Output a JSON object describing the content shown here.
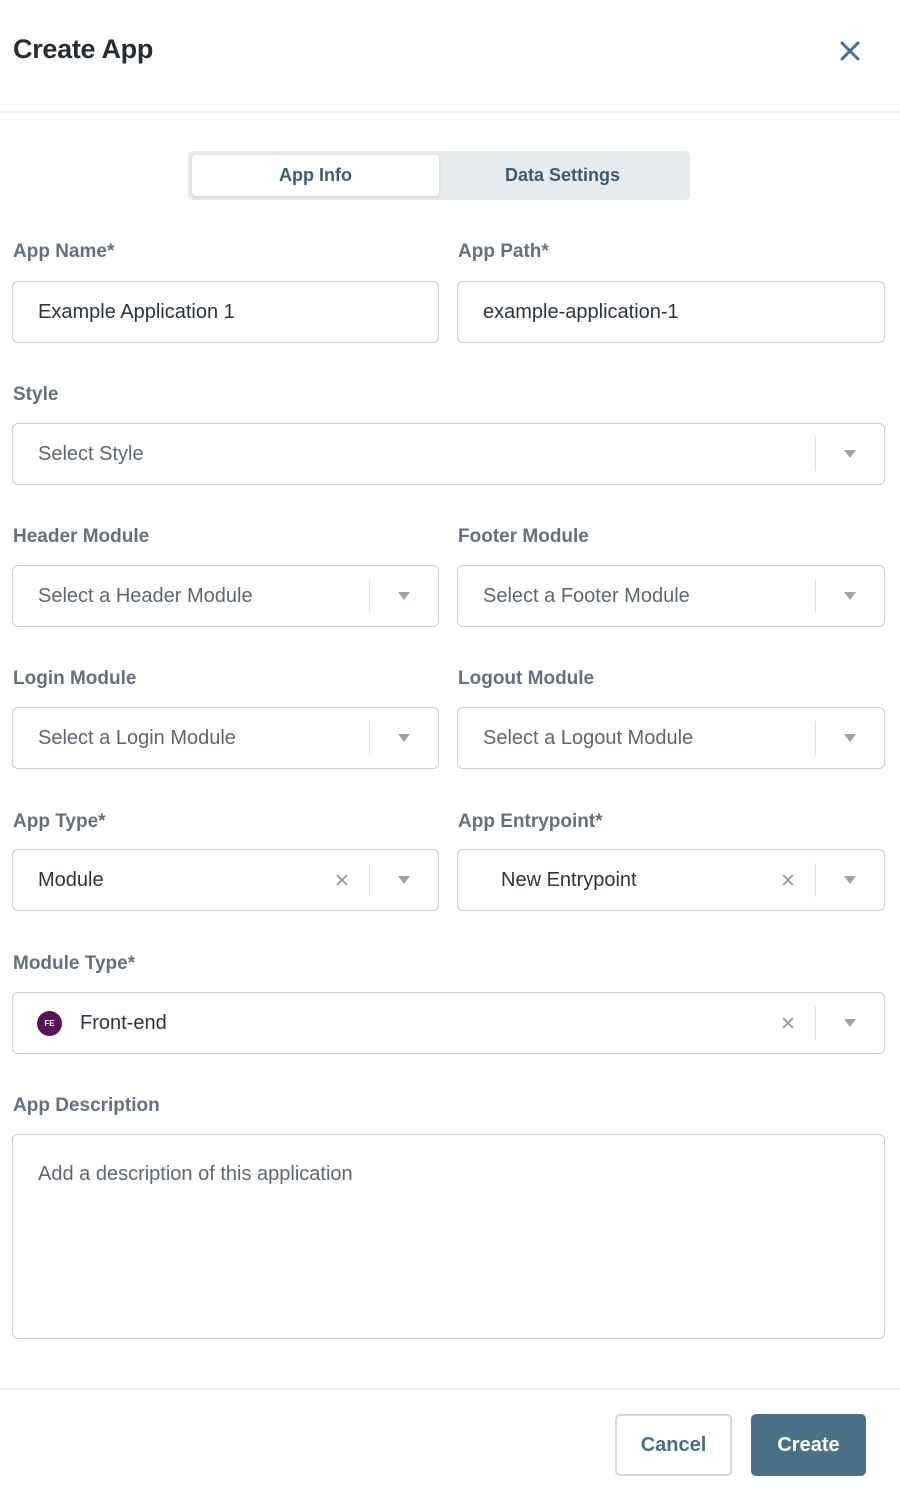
{
  "dialog": {
    "title": "Create App",
    "close_icon": "close-icon"
  },
  "tabs": [
    {
      "label": "App Info",
      "active": true
    },
    {
      "label": "Data Settings",
      "active": false
    }
  ],
  "fields": {
    "app_name": {
      "label": "App Name*",
      "value": "Example Application 1"
    },
    "app_path": {
      "label": "App Path*",
      "value": "example-application-1"
    },
    "style": {
      "label": "Style",
      "placeholder": "Select Style"
    },
    "header_module": {
      "label": "Header Module",
      "placeholder": "Select a Header Module"
    },
    "footer_module": {
      "label": "Footer Module",
      "placeholder": "Select a Footer Module"
    },
    "login_module": {
      "label": "Login Module",
      "placeholder": "Select a Login Module"
    },
    "logout_module": {
      "label": "Logout Module",
      "placeholder": "Select a Logout Module"
    },
    "app_type": {
      "label": "App Type*",
      "value": "Module"
    },
    "app_entrypoint": {
      "label": "App Entrypoint*",
      "value": "New Entrypoint"
    },
    "module_type": {
      "label": "Module Type*",
      "value": "Front-end",
      "badge": "FE",
      "badge_color": "#5a1155"
    },
    "app_description": {
      "label": "App Description",
      "placeholder": "Add a description of this application"
    }
  },
  "footer": {
    "cancel_label": "Cancel",
    "create_label": "Create"
  },
  "colors": {
    "primary": "#4a7187",
    "title": "#262d36",
    "label": "#656f7d",
    "border": "#c5cbd3"
  }
}
